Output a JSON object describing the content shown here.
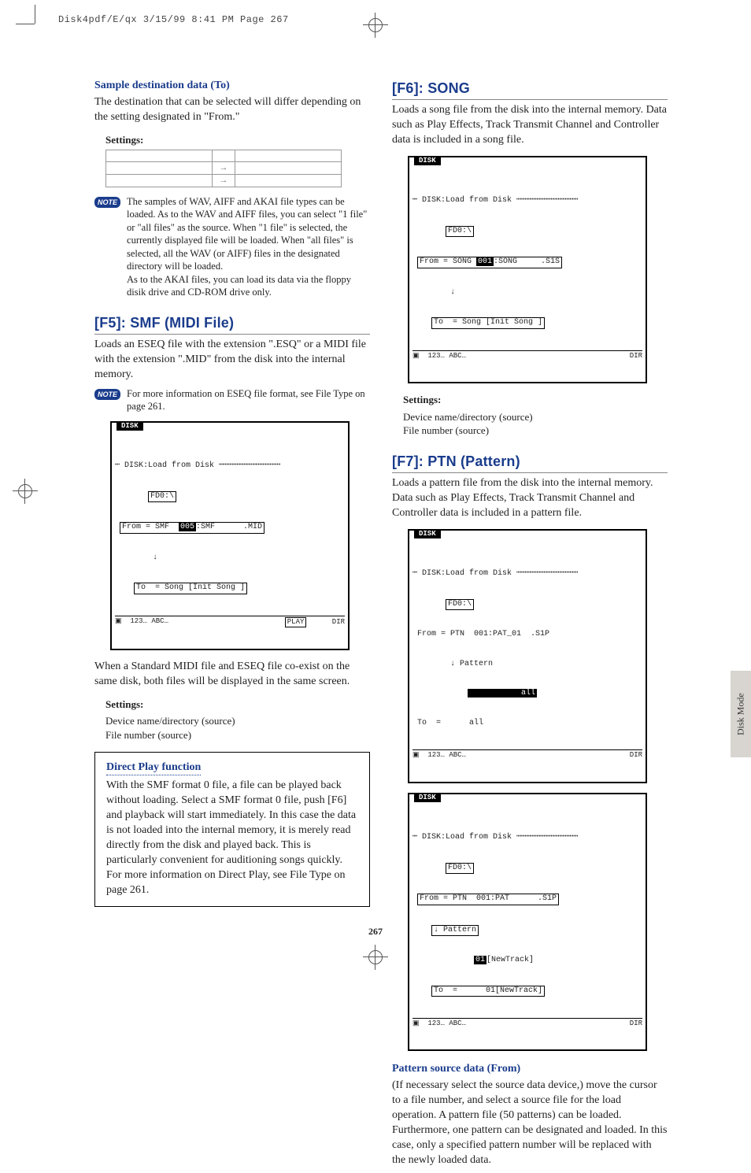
{
  "header": "Disk4pdf/E/qx  3/15/99  8:41 PM  Page 267",
  "page_number": "267",
  "side_tab": "Disk Mode",
  "note_badge": "NOTE",
  "left": {
    "sample_dest_head": "Sample destination data (To)",
    "sample_dest_body": "The destination that can be selected will differ depending on the setting designated in \"From.\"",
    "settings_label": "Settings:",
    "note1": "The samples of WAV, AIFF and AKAI file types can be loaded. As to the WAV and AIFF files, you can select \"1 file\" or \"all files\" as the source. When \"1 file\" is selected, the currently displayed file will be loaded. When \"all files\" is selected, all the WAV (or AIFF) files in the designated directory will be loaded.\nAs to the AKAI files, you can load its data via the floppy disik drive and CD-ROM drive only.",
    "f5_head": "[F5]: SMF (MIDI File)",
    "f5_body": "Loads an ESEQ file with the extension \".ESQ\" or a MIDI file with the extension \".MID\" from the disk into the internal memory.",
    "note2": "For more information on ESEQ file format, see File Type on page 261.",
    "lcd1": {
      "tab": "DISK",
      "l1": "DISK:Load from Disk",
      "l2": "FD0:\\",
      "l3a": "From = SMF  ",
      "l3b": "005",
      "l3c": ":SMF      .MID",
      "l4": "To  = Song [Init Song ]",
      "bar_left": "123… ABC…",
      "bar_mid": "PLAY",
      "bar_right": "DIR"
    },
    "after_lcd": "When a Standard MIDI file and ESEQ file co-exist on the same disk, both files will be displayed in the same screen.",
    "settings2_label": "Settings:",
    "settings2_body": "Device name/directory (source)\nFile number (source)",
    "direct_head": "Direct Play function",
    "direct_body": "With the SMF format 0 file, a file can be played back without loading. Select a SMF format 0 file, push [F6] and playback will start immediately. In this case the data is not loaded into the internal memory, it is merely read directly from the disk and played back. This is particularly convenient for auditioning songs quickly. For more information on Direct Play, see File Type on page 261."
  },
  "right": {
    "f6_head": "[F6]: SONG",
    "f6_body": "Loads a song file from the disk into the internal memory. Data such as Play Effects, Track Transmit Channel and Controller data is included in a song file.",
    "lcd2": {
      "tab": "DISK",
      "l1": "DISK:Load from Disk",
      "l2": "FD0:\\",
      "l3a": "From = SONG ",
      "l3b": "001",
      "l3c": ":SONG     .S1S",
      "l4": "To  = Song [Init Song ]",
      "bar_left": "123… ABC…",
      "bar_right": "DIR"
    },
    "settings_label": "Settings:",
    "settings_body": "Device name/directory (source)\nFile number (source)",
    "f7_head": "[F7]: PTN (Pattern)",
    "f7_body": "Loads a pattern file from the disk into the internal memory. Data such as Play Effects, Track Transmit Channel and Controller data is included in a pattern file.",
    "lcd3": {
      "tab": "DISK",
      "l1": "DISK:Load from Disk",
      "l2": "FD0:\\",
      "l3": "From = PTN  001:PAT_01  .S1P",
      "l4": "↓ Pattern",
      "l5": "           all",
      "l6": "To  =      all",
      "bar_left": "123… ABC…",
      "bar_right": "DIR"
    },
    "lcd4": {
      "tab": "DISK",
      "l1": "DISK:Load from Disk",
      "l2": "FD0:\\",
      "l3a": "From = PTN  001:PAT      .S1P",
      "l4a": "↓ Pattern",
      "l4b": "01",
      "l4c": "[NewTrack]",
      "l5": "To  =      01[NewTrack]",
      "bar_left": "123… ABC…",
      "bar_right": "DIR"
    },
    "pattern_head": "Pattern source data (From)",
    "pattern_body": "(If necessary select the source data device,) move the cursor to a file number, and select a source file for the load operation. A pattern file (50 patterns) can be loaded. Furthermore, one pattern can be designated and loaded. In this case, only a specified pattern number will be replaced with the newly loaded data."
  }
}
